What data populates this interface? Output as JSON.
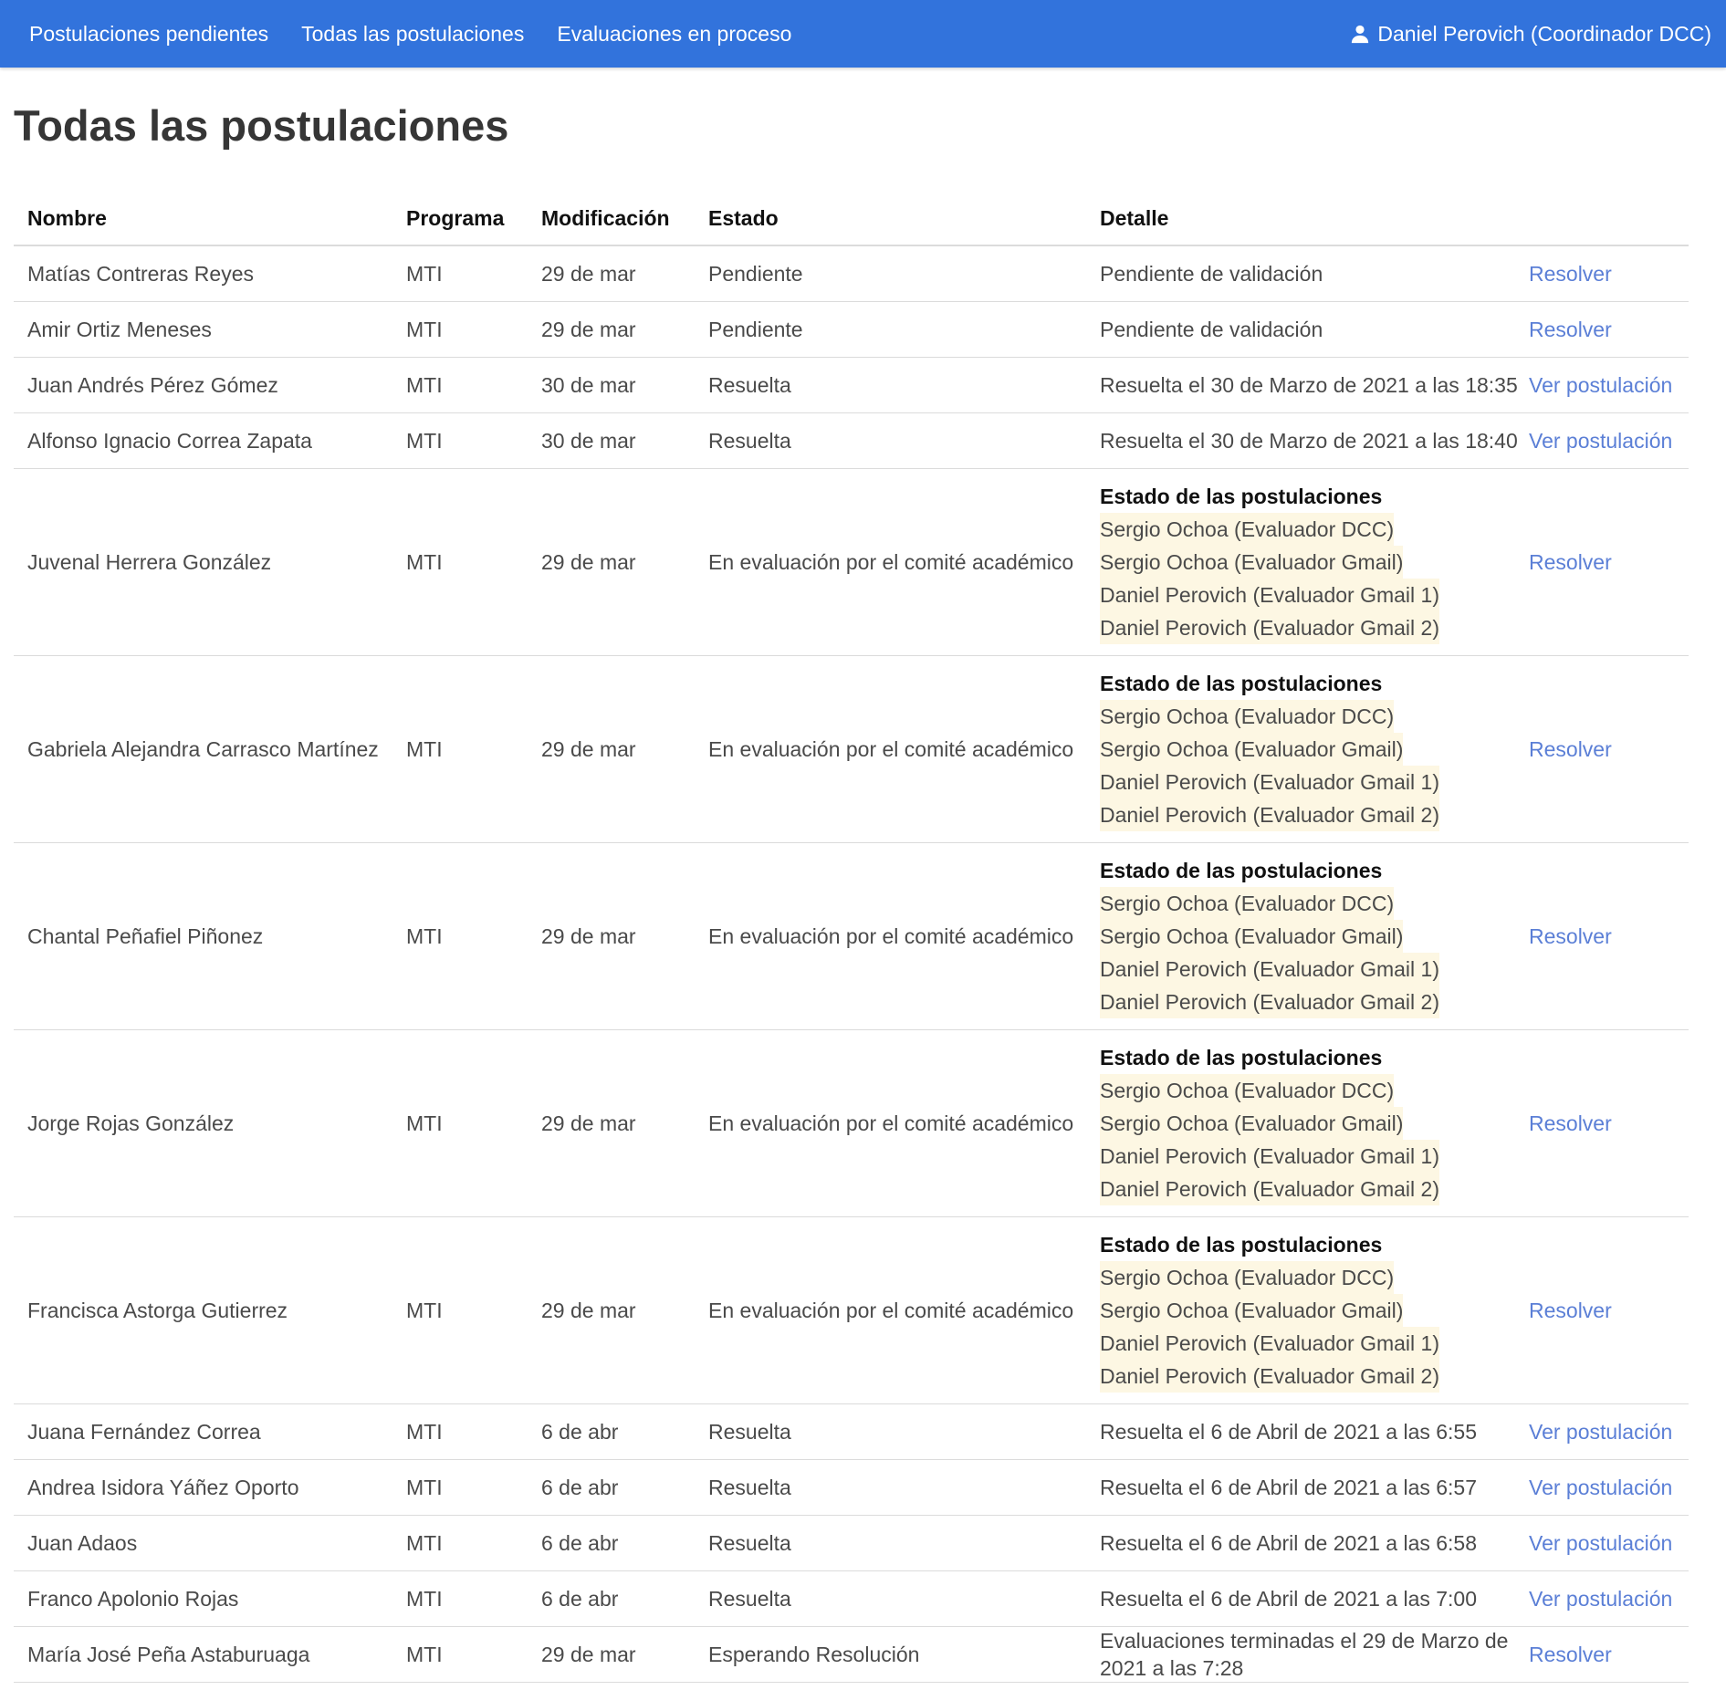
{
  "nav": {
    "links": [
      "Postulaciones pendientes",
      "Todas las postulaciones",
      "Evaluaciones en proceso"
    ],
    "user": "Daniel Perovich (Coordinador DCC)",
    "user_icon": "user-icon",
    "bg_color": "#3273dc"
  },
  "page": {
    "title": "Todas las postulaciones"
  },
  "table": {
    "headers": {
      "nombre": "Nombre",
      "programa": "Programa",
      "modificacion": "Modificación",
      "estado": "Estado",
      "detalle": "Detalle"
    },
    "rows": [
      {
        "nombre": "Matías Contreras Reyes",
        "programa": "MTI",
        "fecha": "29 de mar",
        "estado": "Pendiente",
        "detalle": "Pendiente de validación",
        "accion": "Resolver"
      },
      {
        "nombre": "Amir Ortiz Meneses",
        "programa": "MTI",
        "fecha": "29 de mar",
        "estado": "Pendiente",
        "detalle": "Pendiente de validación",
        "accion": "Resolver"
      },
      {
        "nombre": "Juan Andrés Pérez Gómez",
        "programa": "MTI",
        "fecha": "30 de mar",
        "estado": "Resuelta",
        "detalle": "Resuelta el 30 de Marzo de 2021 a las 18:35",
        "accion": "Ver postulación"
      },
      {
        "nombre": "Alfonso Ignacio Correa Zapata",
        "programa": "MTI",
        "fecha": "30 de mar",
        "estado": "Resuelta",
        "detalle": "Resuelta el 30 de Marzo de 2021 a las 18:40",
        "accion": "Ver postulación"
      },
      {
        "nombre": "Juvenal Herrera González",
        "programa": "MTI",
        "fecha": "29 de mar",
        "estado": "En evaluación por el comité académico",
        "detalle_title": "Estado de las postulaciones",
        "evaluadores": [
          "Sergio Ochoa (Evaluador DCC)",
          "Sergio Ochoa (Evaluador Gmail)",
          "Daniel Perovich (Evaluador Gmail 1)",
          "Daniel Perovich (Evaluador Gmail 2)"
        ],
        "accion": "Resolver"
      },
      {
        "nombre": "Gabriela Alejandra Carrasco Martínez",
        "programa": "MTI",
        "fecha": "29 de mar",
        "estado": "En evaluación por el comité académico",
        "detalle_title": "Estado de las postulaciones",
        "evaluadores": [
          "Sergio Ochoa (Evaluador DCC)",
          "Sergio Ochoa (Evaluador Gmail)",
          "Daniel Perovich (Evaluador Gmail 1)",
          "Daniel Perovich (Evaluador Gmail 2)"
        ],
        "accion": "Resolver"
      },
      {
        "nombre": "Chantal Peñafiel Piñonez",
        "programa": "MTI",
        "fecha": "29 de mar",
        "estado": "En evaluación por el comité académico",
        "detalle_title": "Estado de las postulaciones",
        "evaluadores": [
          "Sergio Ochoa (Evaluador DCC)",
          "Sergio Ochoa (Evaluador Gmail)",
          "Daniel Perovich (Evaluador Gmail 1)",
          "Daniel Perovich (Evaluador Gmail 2)"
        ],
        "accion": "Resolver"
      },
      {
        "nombre": "Jorge Rojas González",
        "programa": "MTI",
        "fecha": "29 de mar",
        "estado": "En evaluación por el comité académico",
        "detalle_title": "Estado de las postulaciones",
        "evaluadores": [
          "Sergio Ochoa (Evaluador DCC)",
          "Sergio Ochoa (Evaluador Gmail)",
          "Daniel Perovich (Evaluador Gmail 1)",
          "Daniel Perovich (Evaluador Gmail 2)"
        ],
        "accion": "Resolver"
      },
      {
        "nombre": "Francisca Astorga Gutierrez",
        "programa": "MTI",
        "fecha": "29 de mar",
        "estado": "En evaluación por el comité académico",
        "detalle_title": "Estado de las postulaciones",
        "evaluadores": [
          "Sergio Ochoa (Evaluador DCC)",
          "Sergio Ochoa (Evaluador Gmail)",
          "Daniel Perovich (Evaluador Gmail 1)",
          "Daniel Perovich (Evaluador Gmail 2)"
        ],
        "accion": "Resolver"
      },
      {
        "nombre": "Juana Fernández Correa",
        "programa": "MTI",
        "fecha": "6 de abr",
        "estado": "Resuelta",
        "detalle": "Resuelta el 6 de Abril de 2021 a las 6:55",
        "accion": "Ver postulación"
      },
      {
        "nombre": "Andrea Isidora Yáñez Oporto",
        "programa": "MTI",
        "fecha": "6 de abr",
        "estado": "Resuelta",
        "detalle": "Resuelta el 6 de Abril de 2021 a las 6:57",
        "accion": "Ver postulación"
      },
      {
        "nombre": "Juan Adaos",
        "programa": "MTI",
        "fecha": "6 de abr",
        "estado": "Resuelta",
        "detalle": "Resuelta el 6 de Abril de 2021 a las 6:58",
        "accion": "Ver postulación"
      },
      {
        "nombre": "Franco Apolonio Rojas",
        "programa": "MTI",
        "fecha": "6 de abr",
        "estado": "Resuelta",
        "detalle": "Resuelta el 6 de Abril de 2021 a las 7:00",
        "accion": "Ver postulación"
      },
      {
        "nombre": "María José Peña Astaburuaga",
        "programa": "MTI",
        "fecha": "29 de mar",
        "estado": "Esperando Resolución",
        "detalle": "Evaluaciones terminadas el 29 de Marzo de 2021 a las 7:28",
        "accion": "Resolver"
      }
    ]
  }
}
